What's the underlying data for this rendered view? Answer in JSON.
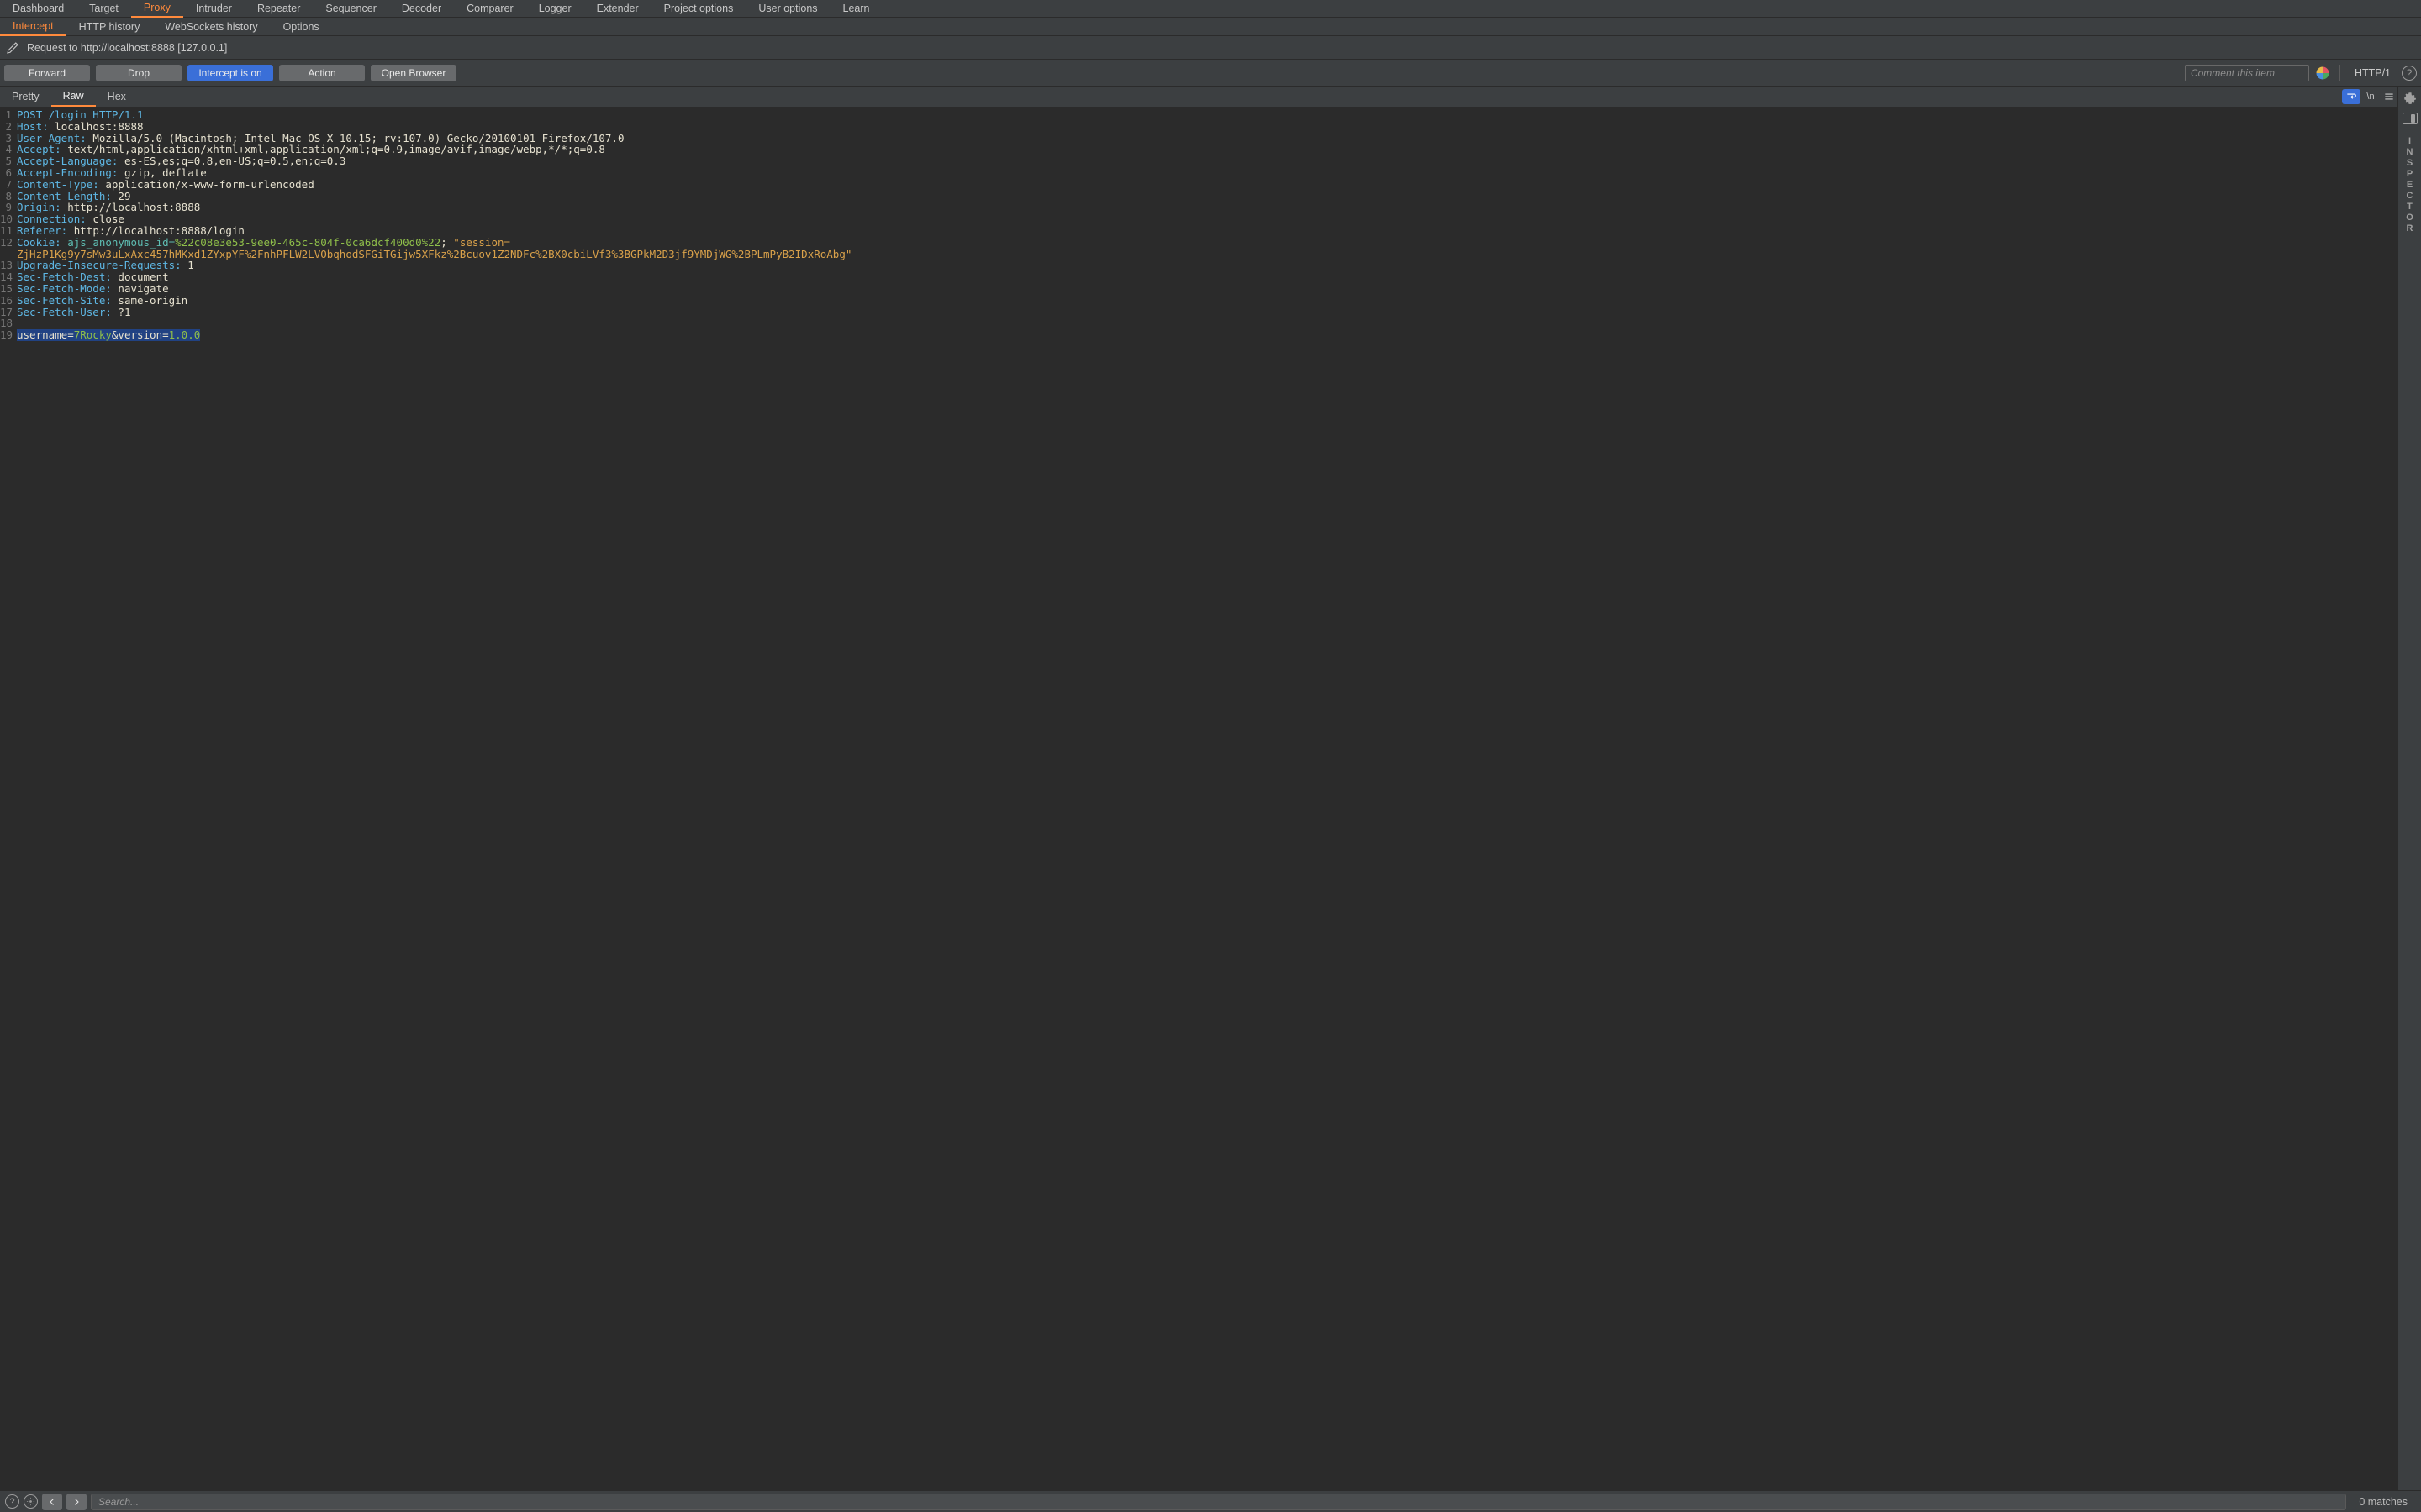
{
  "top_tabs": [
    "Dashboard",
    "Target",
    "Proxy",
    "Intruder",
    "Repeater",
    "Sequencer",
    "Decoder",
    "Comparer",
    "Logger",
    "Extender",
    "Project options",
    "User options",
    "Learn"
  ],
  "top_active": 2,
  "sub_tabs": [
    "Intercept",
    "HTTP history",
    "WebSockets history",
    "Options"
  ],
  "sub_active": 0,
  "request_line": "Request to http://localhost:8888  [127.0.0.1]",
  "buttons": {
    "forward": "Forward",
    "drop": "Drop",
    "intercept": "Intercept is on",
    "action": "Action",
    "open_browser": "Open Browser"
  },
  "comment_placeholder": "Comment this item",
  "http_version": "HTTP/1",
  "editor_tabs": [
    "Pretty",
    "Raw",
    "Hex"
  ],
  "editor_active": 1,
  "nl_label": "\\n",
  "inspector_label": "INSPECTOR",
  "lines": [
    {
      "n": 1,
      "segs": [
        {
          "t": "POST /login HTTP/1.1",
          "c": "kw"
        }
      ]
    },
    {
      "n": 2,
      "segs": [
        {
          "t": "Host:",
          "c": "kw"
        },
        {
          "t": " localhost:8888"
        }
      ]
    },
    {
      "n": 3,
      "segs": [
        {
          "t": "User-Agent:",
          "c": "kw"
        },
        {
          "t": " Mozilla/5.0 (Macintosh; Intel Mac OS X 10.15; rv:107.0) Gecko/20100101 Firefox/107.0"
        }
      ]
    },
    {
      "n": 4,
      "segs": [
        {
          "t": "Accept:",
          "c": "kw"
        },
        {
          "t": " text/html,application/xhtml+xml,application/xml;q=0.9,image/avif,image/webp,*/*;q=0.8"
        }
      ]
    },
    {
      "n": 5,
      "segs": [
        {
          "t": "Accept-Language:",
          "c": "kw"
        },
        {
          "t": " es-ES,es;q=0.8,en-US;q=0.5,en;q=0.3"
        }
      ]
    },
    {
      "n": 6,
      "segs": [
        {
          "t": "Accept-Encoding:",
          "c": "kw"
        },
        {
          "t": " gzip, deflate"
        }
      ]
    },
    {
      "n": 7,
      "segs": [
        {
          "t": "Content-Type:",
          "c": "kw"
        },
        {
          "t": " application/x-www-form-urlencoded"
        }
      ]
    },
    {
      "n": 8,
      "segs": [
        {
          "t": "Content-Length:",
          "c": "kw"
        },
        {
          "t": " 29"
        }
      ]
    },
    {
      "n": 9,
      "segs": [
        {
          "t": "Origin:",
          "c": "kw"
        },
        {
          "t": " http://localhost:8888"
        }
      ]
    },
    {
      "n": 10,
      "segs": [
        {
          "t": "Connection:",
          "c": "kw"
        },
        {
          "t": " close"
        }
      ]
    },
    {
      "n": 11,
      "segs": [
        {
          "t": "Referer:",
          "c": "kw"
        },
        {
          "t": " http://localhost:8888/login"
        }
      ]
    },
    {
      "n": 12,
      "segs": [
        {
          "t": "Cookie:",
          "c": "kw"
        },
        {
          "t": " "
        },
        {
          "t": "ajs_anonymous_id=",
          "c": "cy"
        },
        {
          "t": "%22c08e3e53-9ee0-465c-804f-0ca6dcf400d0%22",
          "c": "gr"
        },
        {
          "t": "; "
        },
        {
          "t": "\"session=",
          "c": "or"
        }
      ]
    },
    {
      "n": "",
      "segs": [
        {
          "t": "ZjHzP1Kg9y7sMw3uLxAxc457hMKxd1ZYxpYF%2FnhPFLW2LVObqhodSFGiTGijw5XFkz%2Bcuov1Z2NDFc%2BX0cbiLVf3%3BGPkM2D3jf9YMDjWG%2BPLmPyB2IDxRoAbg\"",
          "c": "or"
        }
      ]
    },
    {
      "n": 13,
      "segs": [
        {
          "t": "Upgrade-Insecure-Requests:",
          "c": "kw"
        },
        {
          "t": " 1"
        }
      ]
    },
    {
      "n": 14,
      "segs": [
        {
          "t": "Sec-Fetch-Dest:",
          "c": "kw"
        },
        {
          "t": " document"
        }
      ]
    },
    {
      "n": 15,
      "segs": [
        {
          "t": "Sec-Fetch-Mode:",
          "c": "kw"
        },
        {
          "t": " navigate"
        }
      ]
    },
    {
      "n": 16,
      "segs": [
        {
          "t": "Sec-Fetch-Site:",
          "c": "kw"
        },
        {
          "t": " same-origin"
        }
      ]
    },
    {
      "n": 17,
      "segs": [
        {
          "t": "Sec-Fetch-User:",
          "c": "kw"
        },
        {
          "t": " ?1"
        }
      ]
    },
    {
      "n": 18,
      "segs": [
        {
          "t": ""
        }
      ]
    },
    {
      "n": 19,
      "sel": true,
      "segs": [
        {
          "t": "username="
        },
        {
          "t": "7Rocky",
          "c": "p2"
        },
        {
          "t": "&version="
        },
        {
          "t": "1.0.0",
          "c": "p2"
        }
      ]
    }
  ],
  "search_placeholder": "Search...",
  "matches": "0 matches"
}
